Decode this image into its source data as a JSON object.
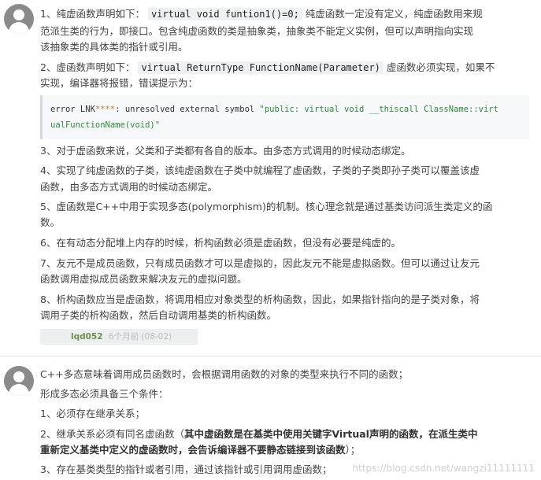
{
  "comment1": {
    "p1": {
      "a": "1、纯虚函数声明如下：",
      "code": "virtual void funtion1()=0;",
      "b": "纯虚函数一定没有定义，纯虚函数用来规",
      "c": "范派生类的行为，即接口。包含纯虚函数的类是抽象类，抽象类不能定义实例，但可以声明指向实现",
      "d": "该抽象类的具体类的指针或引用。"
    },
    "p2": {
      "a": "2、虚函数声明如下：",
      "code": "virtual ReturnType FunctionName(Parameter)",
      "b": "虚函数必须实现，如果不",
      "c": "实现，编译器将报错，错误提示为："
    },
    "code_block": {
      "l1_prefix": "error LNK",
      "l1_stars": "****",
      "l1_mid": ": unresolved external symbol ",
      "l1_str": "\"public: virtual void __thiscall ClassName::virt",
      "l2_str": "ualFunctionName(void)\""
    },
    "p3": "3、对于虚函数来说，父类和子类都有各自的版本。由多态方式调用的时候动态绑定。",
    "p4": {
      "a": "4、实现了纯虚函数的子类，该纯虚函数在子类中就编程了虚函数，子类的子类即孙子类可以覆盖该虚",
      "b": "函数，由多态方式调用的时候动态绑定。"
    },
    "p5": {
      "a": "5、虚函数是C++中用于实现多态(polymorphism)的机制。核心理念就是通过基类访问派生类定义的函",
      "b": "数。"
    },
    "p6": "6、在有动态分配堆上内存的时候，析构函数必须是虚函数，但没有必要是纯虚的。",
    "p7": {
      "a": "7、友元不是成员函数，只有成员函数才可以是虚拟的，因此友元不能是虚拟函数。但可以通过让友元",
      "b": "函数调用虚拟成员函数来解决友元的虚拟问题。"
    },
    "p8": {
      "a": "8、析构函数应当是虚函数，将调用相应对象类型的析构函数，因此，如果指针指向的是子类对象，将",
      "b": "调用子类的析构函数，然后自动调用基类的析构函数。"
    },
    "meta": {
      "user": "lqd052",
      "time": "6个月前 (08-02)"
    }
  },
  "comment2": {
    "l1": "C++多态意味着调用成员函数时，会根据调用函数的对象的类型来执行不同的函数；",
    "l2": "形成多态必须具备三个条件：",
    "l3": "1、必须存在继承关系；",
    "l4": {
      "a": "2、继承关系必须有同名虚函数（",
      "bold_a": "其中虚函数是在基类中使用关键字Virtual声明的函数，在派生类中",
      "bold_b": "重新定义基类中定义的虚函数时，会告诉编译器不要静态链接到该函数",
      "b": "）；"
    },
    "l5": "3、存在基类类型的指针或者引用，通过该指针或引用调用虚函数；"
  },
  "watermark": "https://blog.csdn.net/wangzi11111111"
}
